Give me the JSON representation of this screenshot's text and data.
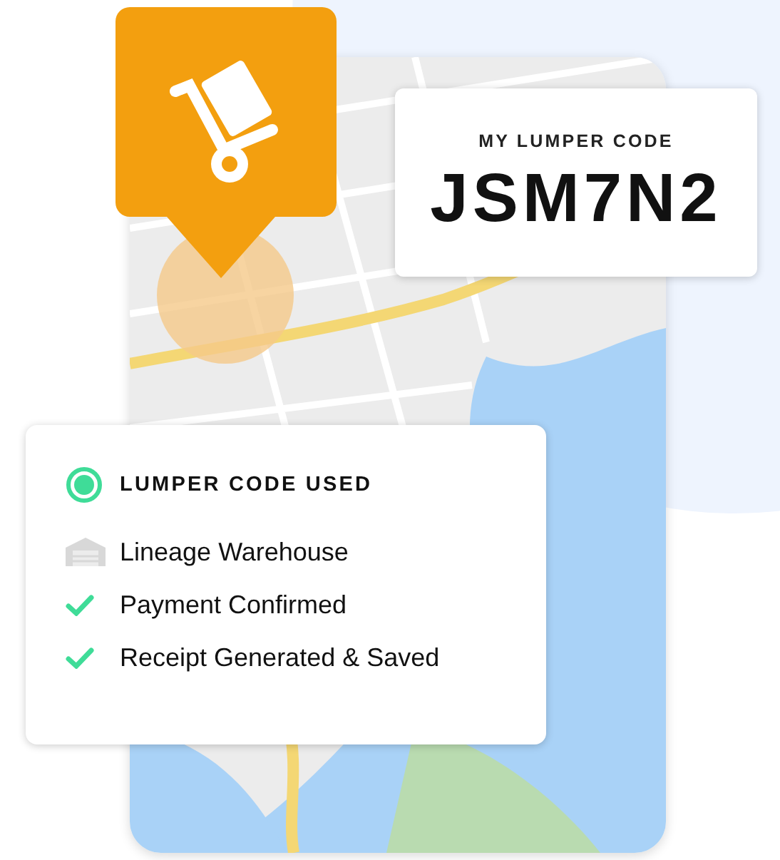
{
  "code_card": {
    "label": "MY LUMPER CODE",
    "code": "JSM7N2"
  },
  "status_card": {
    "items": [
      {
        "kind": "status",
        "text": "LUMPER CODE USED"
      },
      {
        "kind": "place",
        "text": "Lineage Warehouse"
      },
      {
        "kind": "check",
        "text": "Payment Confirmed"
      },
      {
        "kind": "check",
        "text": "Receipt Generated & Saved"
      }
    ]
  }
}
